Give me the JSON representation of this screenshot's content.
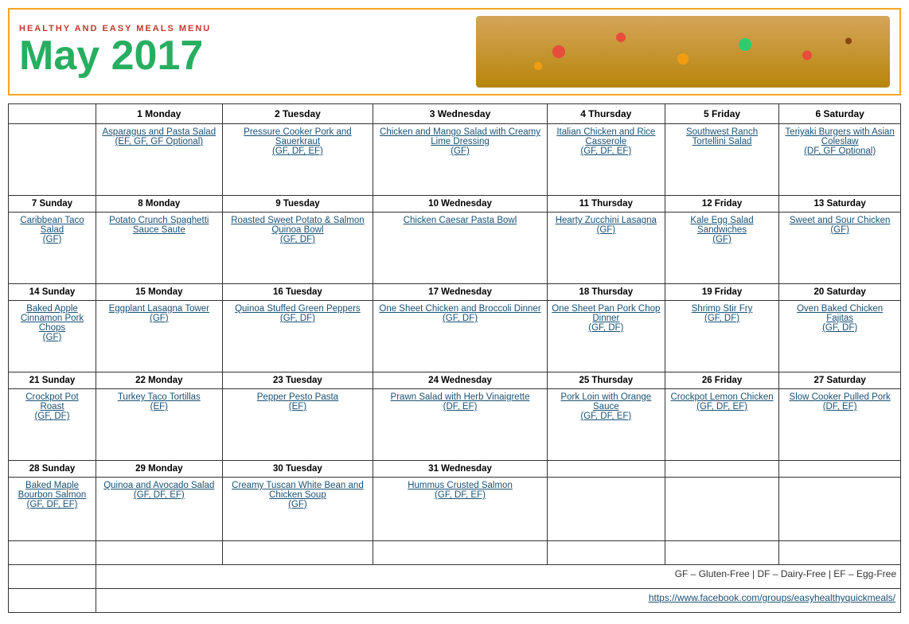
{
  "header": {
    "subtitle": "Healthy and Easy Meals Menu",
    "title": "May 2017"
  },
  "days_row": [
    "",
    "1 Monday",
    "2 Tuesday",
    "3 Wednesday",
    "4 Thursday",
    "5 Friday",
    "6 Saturday"
  ],
  "week1": {
    "sunday": "",
    "monday": {
      "name": "Asparagus and Pasta Salad",
      "tags": "(EF, GF, GF Optional)"
    },
    "tuesday": {
      "name": "Pressure Cooker Pork and Sauerkraut",
      "tags": "(GF, DF, EF)"
    },
    "wednesday": {
      "name": "Chicken and Mango Salad with Creamy Lime Dressing",
      "tags": "(GF)"
    },
    "thursday": {
      "name": "Italian Chicken and Rice Casserole",
      "tags": "(GF, DF, EF)"
    },
    "friday": {
      "name": "Southwest Ranch Tortellini Salad",
      "tags": ""
    },
    "saturday": {
      "name": "Teriyaki Burgers with Asian Coleslaw",
      "tags": "(DF, GF Optional)"
    }
  },
  "week2_header": [
    "7 Sunday",
    "8 Monday",
    "9 Tuesday",
    "10 Wednesday",
    "11 Thursday",
    "12 Friday",
    "13 Saturday"
  ],
  "week2": {
    "sunday": {
      "name": "Caribbean Taco Salad",
      "tags": "(GF)"
    },
    "monday": {
      "name": "Potato Crunch Spaghetti Sauce Saute",
      "tags": ""
    },
    "tuesday": {
      "name": "Roasted Sweet Potato & Salmon Quinoa Bowl",
      "tags": "(GF, DF)"
    },
    "wednesday": {
      "name": "Chicken Caesar Pasta Bowl",
      "tags": ""
    },
    "thursday": {
      "name": "Hearty Zucchini Lasagna",
      "tags": "(GF)"
    },
    "friday": {
      "name": "Kale Egg Salad Sandwiches",
      "tags": "(GF)"
    },
    "saturday": {
      "name": "Sweet and Sour Chicken",
      "tags": "(GF)"
    }
  },
  "week3_header": [
    "14 Sunday",
    "15 Monday",
    "16 Tuesday",
    "17 Wednesday",
    "18 Thursday",
    "19 Friday",
    "20 Saturday"
  ],
  "week3": {
    "sunday": {
      "name": "Baked Apple Cinnamon Pork Chops",
      "tags": "(GF)"
    },
    "monday": {
      "name": "Eggplant Lasagna Tower",
      "tags": "(GF)"
    },
    "tuesday": {
      "name": "Quinoa Stuffed Green Peppers",
      "tags": "(GF, DF)"
    },
    "wednesday": {
      "name": "One Sheet Chicken and Broccoli Dinner",
      "tags": "(GF, DF)"
    },
    "thursday": {
      "name": "One Sheet Pan Pork Chop Dinner",
      "tags": "(GF, DF)"
    },
    "friday": {
      "name": "Shrimp Stir Fry",
      "tags": "(GF, DF)"
    },
    "saturday": {
      "name": "Oven Baked Chicken Fajitas",
      "tags": "(GF, DF)"
    }
  },
  "week4_header": [
    "21 Sunday",
    "22 Monday",
    "23 Tuesday",
    "24 Wednesday",
    "25 Thursday",
    "26 Friday",
    "27 Saturday"
  ],
  "week4": {
    "sunday": {
      "name": "Crockpot Pot Roast",
      "tags": "(GF, DF)"
    },
    "monday": {
      "name": "Turkey Taco Tortillas",
      "tags": "(EF)"
    },
    "tuesday": {
      "name": "Pepper Pesto Pasta",
      "tags": "(EF)"
    },
    "wednesday": {
      "name": "Prawn Salad with Herb Vinaigrette",
      "tags": "(DF, EF)"
    },
    "thursday": {
      "name": "Pork Loin with Orange Sauce",
      "tags": "(GF, DF, EF)"
    },
    "friday": {
      "name": "Crockpot Lemon Chicken",
      "tags": "(GF, DF, EF)"
    },
    "saturday": {
      "name": "Slow Cooker Pulled Pork",
      "tags": "(DF, EF)"
    }
  },
  "week5_header": [
    "28 Sunday",
    "29 Monday",
    "30 Tuesday",
    "31 Wednesday",
    "",
    "",
    ""
  ],
  "week5": {
    "sunday": {
      "name": "Baked Maple Bourbon Salmon",
      "tags": "(GF, DF, EF)"
    },
    "monday": {
      "name": "Quinoa and Avocado Salad",
      "tags": "(GF, DF, EF)"
    },
    "tuesday": {
      "name": "Creamy Tuscan White Bean and Chicken Soup",
      "tags": "(GF)"
    },
    "wednesday": {
      "name": "Hummus Crusted Salmon",
      "tags": "(GF, DF, EF)"
    }
  },
  "legend": "GF – Gluten-Free  |  DF – Dairy-Free  |  EF – Egg-Free",
  "footer_link": "https://www.facebook.com/groups/easyhealthyquickmeals/"
}
